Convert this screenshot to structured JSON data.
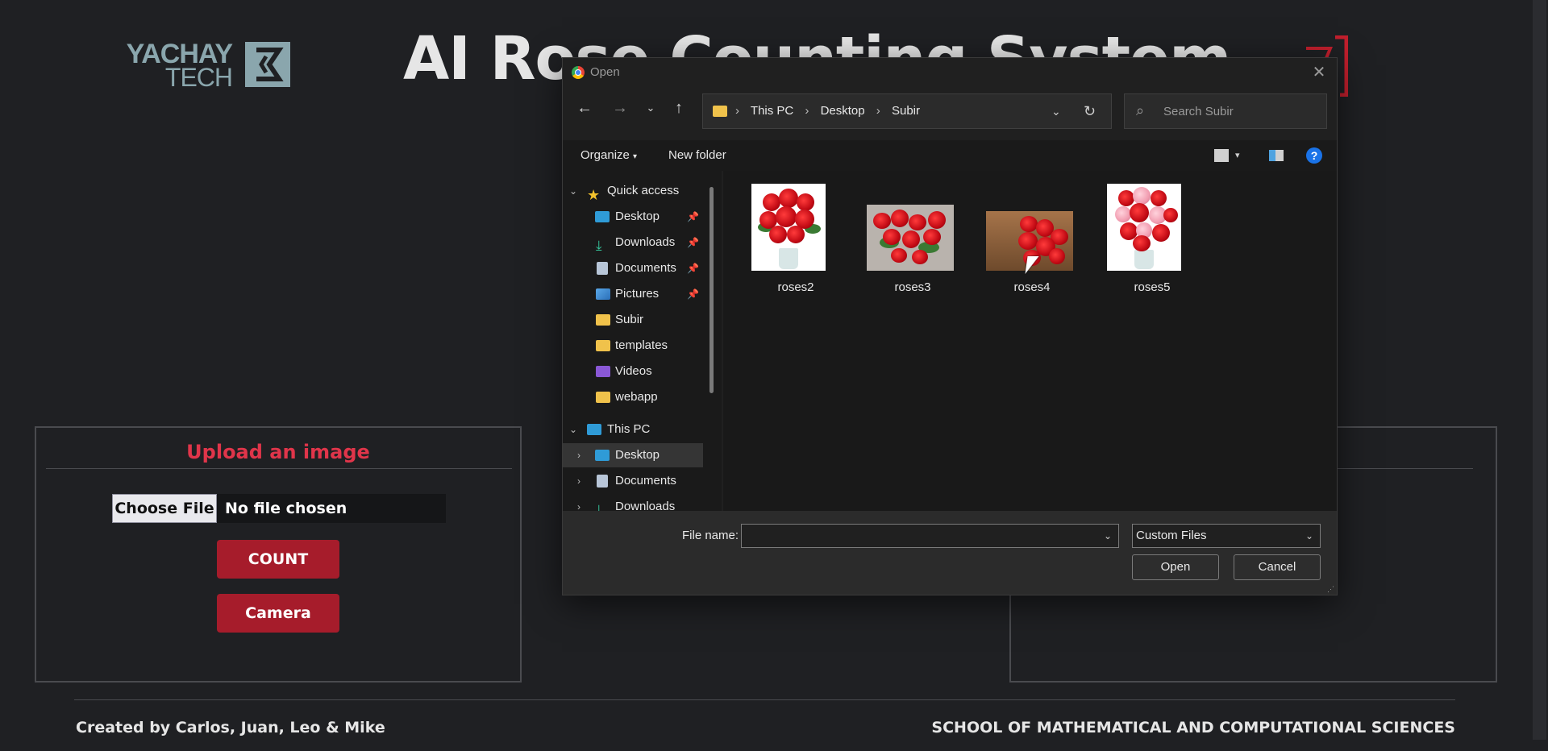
{
  "page": {
    "logo_line1": "YACHAY",
    "logo_line2": "TECH",
    "title": "AI Rose Counting System",
    "upload_title": "Upload an image",
    "choose_file_label": "Choose File",
    "no_file_text": "No file chosen",
    "count_label": "COUNT",
    "camera_label": "Camera",
    "footer_left": "Created by Carlos, Juan, Leo & Mike",
    "footer_right": "SCHOOL OF MATHEMATICAL AND COMPUTATIONAL SCIENCES",
    "accent_color": "#e0354a",
    "button_color": "#a61c2b"
  },
  "dialog": {
    "title": "Open",
    "breadcrumbs": [
      "This PC",
      "Desktop",
      "Subir"
    ],
    "search_placeholder": "Search Subir",
    "organize_label": "Organize",
    "new_folder_label": "New folder",
    "nav_items": [
      {
        "label": "Quick access",
        "icon": "star-icon"
      },
      {
        "label": "Desktop",
        "icon": "desktop-icon"
      },
      {
        "label": "Downloads",
        "icon": "download-icon"
      },
      {
        "label": "Documents",
        "icon": "document-icon"
      },
      {
        "label": "Pictures",
        "icon": "pictures-icon"
      },
      {
        "label": "Subir",
        "icon": "folder-icon"
      },
      {
        "label": "templates",
        "icon": "folder-icon"
      },
      {
        "label": "Videos",
        "icon": "video-icon"
      },
      {
        "label": "webapp",
        "icon": "folder-icon"
      },
      {
        "label": "This PC",
        "icon": "computer-icon"
      },
      {
        "label": "Desktop",
        "icon": "desktop-icon"
      },
      {
        "label": "Documents",
        "icon": "document-icon"
      },
      {
        "label": "Downloads",
        "icon": "download-icon"
      }
    ],
    "files": [
      {
        "name": "roses2"
      },
      {
        "name": "roses3"
      },
      {
        "name": "roses4"
      },
      {
        "name": "roses5"
      }
    ],
    "file_name_label": "File name:",
    "file_name_value": "",
    "file_type": "Custom Files",
    "open_label": "Open",
    "cancel_label": "Cancel"
  }
}
